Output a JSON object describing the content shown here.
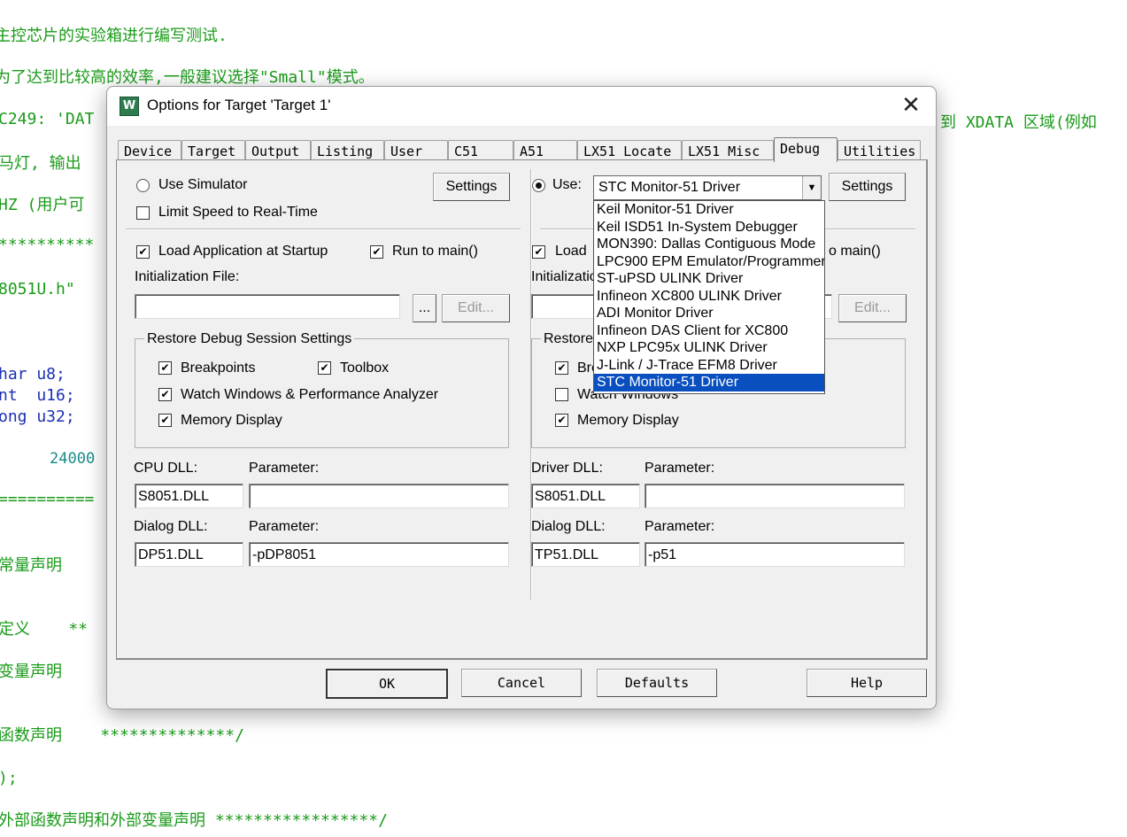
{
  "editor": {
    "lines": [
      "主控芯片的实验箱进行编写测试.",
      "为了达到比较高的效率,一般建议选择\"Small\"模式。",
      "C249: 'DAT",
      "马灯, 输出",
      "HZ (用户可",
      "**********",
      "8051U.h\"",
      "har u8;",
      "nt  u16;",
      "ong u32;",
      "24000",
      "==========",
      "常量声明",
      "定义    **",
      "变量声明",
      "函数声明    **************/",
      ");",
      "外部函数声明和外部变量声明 *****************/",
      "到 XDATA 区域(例如"
    ]
  },
  "dialog": {
    "icon_letter": "W",
    "title": "Options for Target 'Target 1'",
    "close": "✕",
    "tabs": [
      "Device",
      "Target",
      "Output",
      "Listing",
      "User",
      "C51",
      "A51",
      "LX51 Locate",
      "LX51 Misc",
      "Debug",
      "Utilities"
    ],
    "active_tab": "Debug",
    "left": {
      "use_simulator": "Use Simulator",
      "settings": "Settings",
      "limit_speed": "Limit Speed to Real-Time",
      "load_app": "Load Application at Startup",
      "run_to_main": "Run to main()",
      "init_file_label": "Initialization File:",
      "browse": "...",
      "edit": "Edit...",
      "restore_title": "Restore Debug Session Settings",
      "breakpoints": "Breakpoints",
      "toolbox": "Toolbox",
      "watch_windows": "Watch Windows & Performance Analyzer",
      "memory_display": "Memory Display",
      "cpu_dll_label": "CPU DLL:",
      "cpu_param_label": "Parameter:",
      "cpu_dll": "S8051.DLL",
      "cpu_param": "",
      "dialog_dll_label": "Dialog DLL:",
      "dialog_param_label": "Parameter:",
      "dialog_dll": "DP51.DLL",
      "dialog_param": "-pDP8051"
    },
    "right": {
      "use": "Use:",
      "driver": "STC Monitor-51 Driver",
      "settings": "Settings",
      "load_app": "Load",
      "run_to_main": "o main()",
      "init_file_label": "Initializatio",
      "edit": "Edit...",
      "restore_title": "Restore",
      "breakpoints": "Bre",
      "watch_windows": "Watch Windows",
      "memory_display": "Memory Display",
      "driver_dll_label": "Driver DLL:",
      "driver_param_label": "Parameter:",
      "driver_dll": "S8051.DLL",
      "driver_param": "",
      "dialog_dll_label": "Dialog DLL:",
      "dialog_param_label": "Parameter:",
      "dialog_dll": "TP51.DLL",
      "dialog_param": "-p51"
    },
    "driver_options": [
      "Keil Monitor-51 Driver",
      "Keil ISD51 In-System Debugger",
      "MON390: Dallas Contiguous Mode",
      "LPC900 EPM Emulator/Programmer",
      "ST-uPSD ULINK Driver",
      "Infineon XC800 ULINK Driver",
      "ADI Monitor Driver",
      "Infineon DAS Client for XC800",
      "NXP LPC95x ULINK Driver",
      "J-Link / J-Trace EFM8 Driver",
      "STC Monitor-51 Driver"
    ],
    "footer": {
      "ok": "OK",
      "cancel": "Cancel",
      "defaults": "Defaults",
      "help": "Help"
    }
  },
  "colors": {
    "code_comment": "#1a9b1a",
    "code_keyword": "#1c2fb5",
    "selection": "#0a4fc0"
  }
}
